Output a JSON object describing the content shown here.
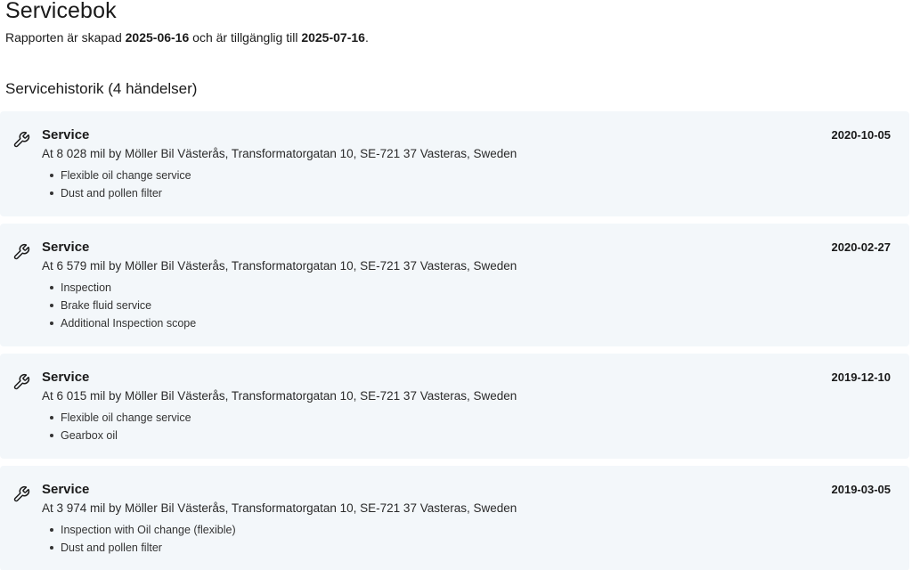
{
  "page": {
    "title": "Servicebok",
    "report": {
      "prefix": "Rapporten är skapad ",
      "created": "2025-06-16",
      "middle": " och är tillgänglig till ",
      "available_until": "2025-07-16",
      "suffix": "."
    },
    "history_heading": "Servicehistorik (4 händelser)"
  },
  "events": [
    {
      "title": "Service",
      "date": "2020-10-05",
      "description": "At 8 028 mil by Möller Bil Västerås, Transformatorgatan 10, SE-721 37 Vasteras, Sweden",
      "items": [
        "Flexible oil change service",
        "Dust and pollen filter"
      ],
      "icon": "wrench-icon"
    },
    {
      "title": "Service",
      "date": "2020-02-27",
      "description": "At 6 579 mil by Möller Bil Västerås, Transformatorgatan 10, SE-721 37 Vasteras, Sweden",
      "items": [
        "Inspection",
        "Brake fluid service",
        "Additional Inspection scope"
      ],
      "icon": "wrench-icon"
    },
    {
      "title": "Service",
      "date": "2019-12-10",
      "description": "At 6 015 mil by Möller Bil Västerås, Transformatorgatan 10, SE-721 37 Vasteras, Sweden",
      "items": [
        "Flexible oil change service",
        "Gearbox oil"
      ],
      "icon": "wrench-icon"
    },
    {
      "title": "Service",
      "date": "2019-03-05",
      "description": "At 3 974 mil by Möller Bil Västerås, Transformatorgatan 10, SE-721 37 Vasteras, Sweden",
      "items": [
        "Inspection with Oil change (flexible)",
        "Dust and pollen filter"
      ],
      "icon": "wrench-icon"
    }
  ],
  "colors": {
    "card_background": "#f3f7fa",
    "text": "#1a1a1a"
  }
}
